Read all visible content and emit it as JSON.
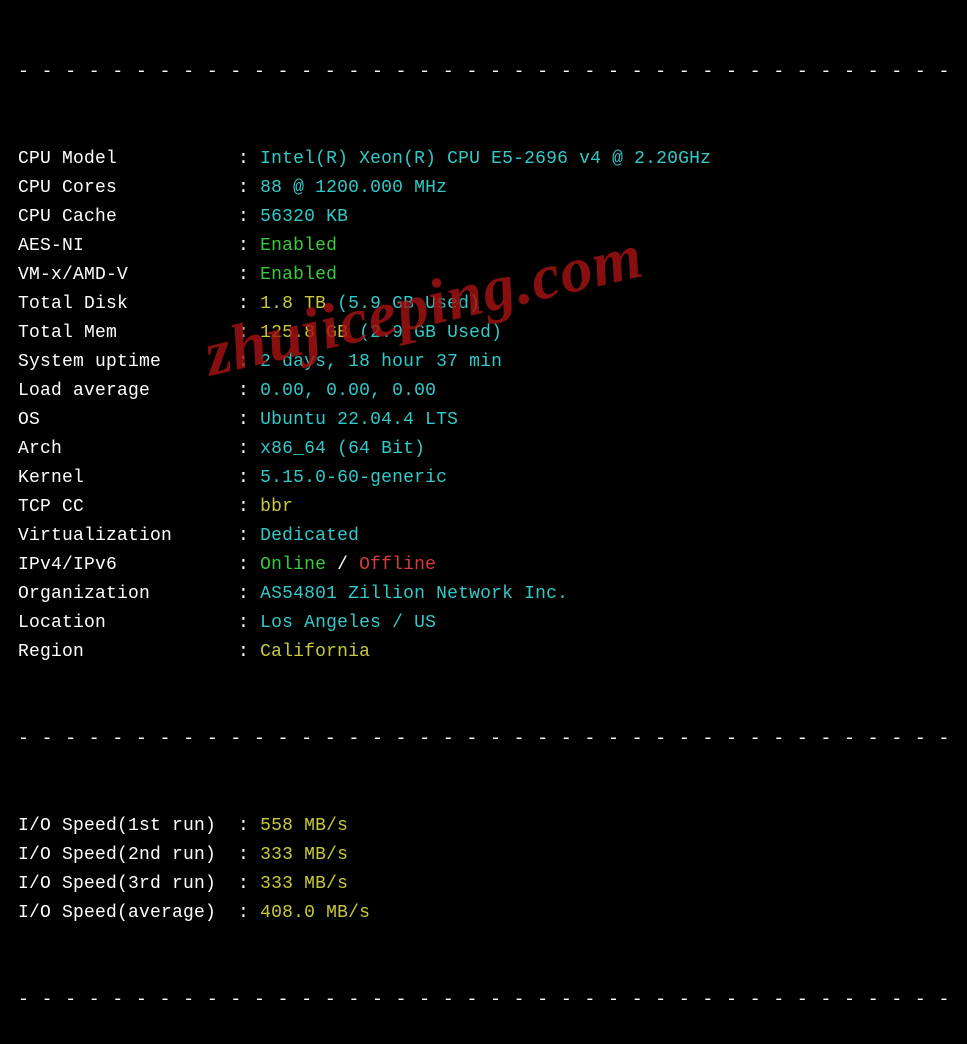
{
  "separator": "- - - - - - - - - - - - - - - - - - - - - - - - - - - - - - - - - - - - - - - - - - - - - - -",
  "rows": [
    {
      "label": "CPU Model",
      "parts": [
        {
          "text": "Intel(R) Xeon(R) CPU E5-2696 v4 @ 2.20GHz",
          "cls": "cyan"
        }
      ]
    },
    {
      "label": "CPU Cores",
      "parts": [
        {
          "text": "88 @ 1200.000 MHz",
          "cls": "cyan"
        }
      ]
    },
    {
      "label": "CPU Cache",
      "parts": [
        {
          "text": "56320 KB",
          "cls": "cyan"
        }
      ]
    },
    {
      "label": "AES-NI",
      "parts": [
        {
          "text": "Enabled",
          "cls": "green"
        }
      ]
    },
    {
      "label": "VM-x/AMD-V",
      "parts": [
        {
          "text": "Enabled",
          "cls": "green"
        }
      ]
    },
    {
      "label": "Total Disk",
      "parts": [
        {
          "text": "1.8 TB",
          "cls": "yellow"
        },
        {
          "text": " (5.9 GB Used)",
          "cls": "cyan"
        }
      ]
    },
    {
      "label": "Total Mem",
      "parts": [
        {
          "text": "125.8 GB",
          "cls": "yellow"
        },
        {
          "text": " (2.9 GB Used)",
          "cls": "cyan"
        }
      ]
    },
    {
      "label": "System uptime",
      "parts": [
        {
          "text": "2 days, 18 hour 37 min",
          "cls": "cyan"
        }
      ]
    },
    {
      "label": "Load average",
      "parts": [
        {
          "text": "0.00, 0.00, 0.00",
          "cls": "cyan"
        }
      ]
    },
    {
      "label": "OS",
      "parts": [
        {
          "text": "Ubuntu 22.04.4 LTS",
          "cls": "cyan"
        }
      ]
    },
    {
      "label": "Arch",
      "parts": [
        {
          "text": "x86_64 (64 Bit)",
          "cls": "cyan"
        }
      ]
    },
    {
      "label": "Kernel",
      "parts": [
        {
          "text": "5.15.0-60-generic",
          "cls": "cyan"
        }
      ]
    },
    {
      "label": "TCP CC",
      "parts": [
        {
          "text": "bbr",
          "cls": "yellow"
        }
      ]
    },
    {
      "label": "Virtualization",
      "parts": [
        {
          "text": "Dedicated",
          "cls": "cyan"
        }
      ]
    },
    {
      "label": "IPv4/IPv6",
      "parts": [
        {
          "text": "Online",
          "cls": "green"
        },
        {
          "text": " / ",
          "cls": "white"
        },
        {
          "text": "Offline",
          "cls": "red"
        }
      ]
    },
    {
      "label": "Organization",
      "parts": [
        {
          "text": "AS54801 Zillion Network Inc.",
          "cls": "cyan"
        }
      ]
    },
    {
      "label": "Location",
      "parts": [
        {
          "text": "Los Angeles / US",
          "cls": "cyan"
        }
      ]
    },
    {
      "label": "Region",
      "parts": [
        {
          "text": "California",
          "cls": "yellow"
        }
      ]
    }
  ],
  "io_rows": [
    {
      "label": "I/O Speed(1st run)",
      "parts": [
        {
          "text": "558 MB/s",
          "cls": "yellow"
        }
      ]
    },
    {
      "label": "I/O Speed(2nd run)",
      "parts": [
        {
          "text": "333 MB/s",
          "cls": "yellow"
        }
      ]
    },
    {
      "label": "I/O Speed(3rd run)",
      "parts": [
        {
          "text": "333 MB/s",
          "cls": "yellow"
        }
      ]
    },
    {
      "label": "I/O Speed(average)",
      "parts": [
        {
          "text": "408.0 MB/s",
          "cls": "yellow"
        }
      ]
    }
  ],
  "watermark": "zhujiceping.com"
}
